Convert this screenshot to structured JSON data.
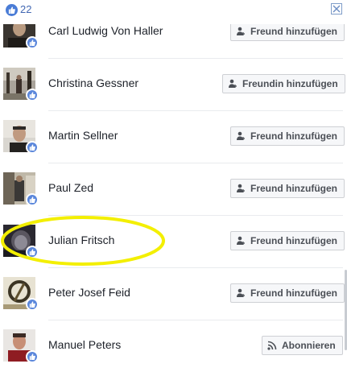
{
  "header": {
    "like_count": "22"
  },
  "people": [
    {
      "name": "Carl Ludwig Von Haller",
      "button": "Freund hinzufügen",
      "button_icon": "add-friend-icon"
    },
    {
      "name": "Christina Gessner",
      "button": "Freundin hinzufügen",
      "button_icon": "add-friend-icon"
    },
    {
      "name": "Martin Sellner",
      "button": "Freund hinzufügen",
      "button_icon": "add-friend-icon"
    },
    {
      "name": "Paul Zed",
      "button": "Freund hinzufügen",
      "button_icon": "add-friend-icon"
    },
    {
      "name": "Julian Fritsch",
      "button": "Freund hinzufügen",
      "button_icon": "add-friend-icon"
    },
    {
      "name": "Peter Josef Feid",
      "button": "Freund hinzufügen",
      "button_icon": "add-friend-icon"
    },
    {
      "name": "Manuel Peters",
      "button": "Abonnieren",
      "button_icon": "rss-icon"
    }
  ],
  "colors": {
    "accent": "#4267b2",
    "highlight": "#f3ef00"
  }
}
